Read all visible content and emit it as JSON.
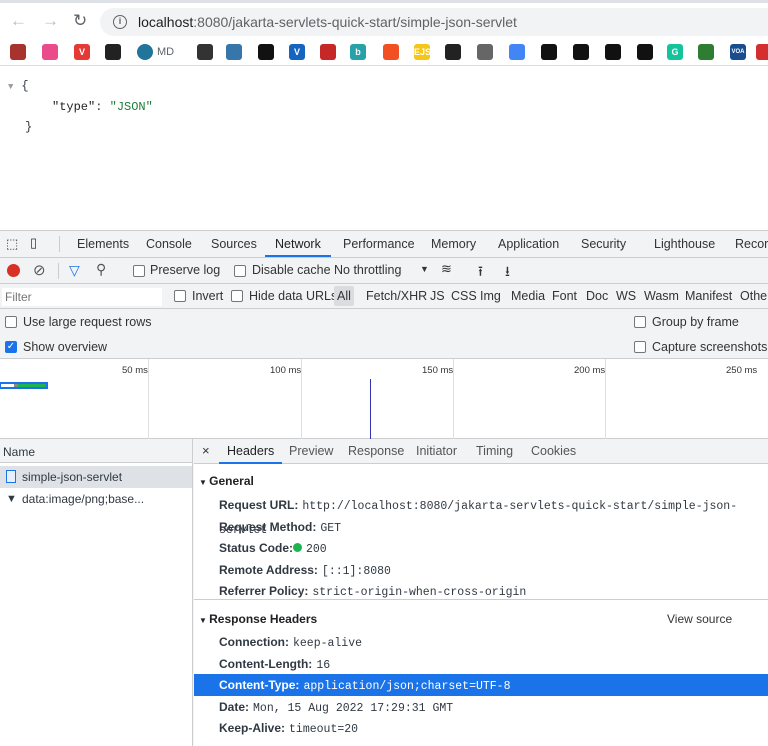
{
  "browser": {
    "url_host": "localhost",
    "url_rest": ":8080/jakarta-servlets-quick-start/simple-json-servlet",
    "bookmarks": [
      {
        "icon": "bars-icon",
        "color": "#a8322d",
        "label": ""
      },
      {
        "icon": "dribbble-icon",
        "color": "#ea4c89",
        "label": ""
      },
      {
        "icon": "vivaldi-icon",
        "color": "#e53935",
        "label": "V"
      },
      {
        "icon": "archive-icon",
        "color": "#222",
        "label": ""
      },
      {
        "icon": "wordpress-icon",
        "color": "#21759b",
        "label": "MD"
      },
      {
        "icon": "tomcat-icon",
        "color": "#333",
        "label": ""
      },
      {
        "icon": "python-icon",
        "color": "#3776ab",
        "label": ""
      },
      {
        "icon": "github-icon",
        "color": "#111",
        "label": ""
      },
      {
        "icon": "vuetify-icon",
        "color": "#1565c0",
        "label": "V"
      },
      {
        "icon": "red-circle-icon",
        "color": "#c62828",
        "label": ""
      },
      {
        "icon": "bing-icon",
        "color": "#27a2a8",
        "label": "b"
      },
      {
        "icon": "microsoft-icon",
        "color": "#f25022",
        "label": ""
      },
      {
        "icon": "ejs-icon",
        "color": "#f5c518",
        "label": "EJS"
      },
      {
        "icon": "archive-icon",
        "color": "#222",
        "label": ""
      },
      {
        "icon": "globe-icon",
        "color": "#666",
        "label": ""
      },
      {
        "icon": "google-docs-icon",
        "color": "#4285f4",
        "label": ""
      },
      {
        "icon": "github-icon",
        "color": "#111",
        "label": ""
      },
      {
        "icon": "github-icon",
        "color": "#111",
        "label": ""
      },
      {
        "icon": "github-icon",
        "color": "#111",
        "label": ""
      },
      {
        "icon": "github-icon",
        "color": "#111",
        "label": ""
      },
      {
        "icon": "grammarly-icon",
        "color": "#15c39a",
        "label": "G"
      },
      {
        "icon": "spring-icon",
        "color": "#2e7d32",
        "label": ""
      },
      {
        "icon": "voa-icon",
        "color": "#1a4d8f",
        "label": "VOA"
      },
      {
        "icon": "red-icon",
        "color": "#d32f2f",
        "label": ""
      }
    ]
  },
  "page": {
    "open": "{",
    "key": "\"type\"",
    "colon": ": ",
    "value": "\"JSON\"",
    "close": "}"
  },
  "devtools": {
    "tabs": [
      "Elements",
      "Console",
      "Sources",
      "Network",
      "Performance",
      "Memory",
      "Application",
      "Security",
      "Lighthouse",
      "Recorder"
    ],
    "active_tab": "Network",
    "toolbar": {
      "preserve_log": "Preserve log",
      "disable_cache": "Disable cache",
      "throttling": "No throttling"
    },
    "filter": {
      "placeholder": "Filter",
      "invert": "Invert",
      "hide_data_urls": "Hide data URLs",
      "types": [
        "All",
        "Fetch/XHR",
        "JS",
        "CSS",
        "Img",
        "Media",
        "Font",
        "Doc",
        "WS",
        "Wasm",
        "Manifest",
        "Other"
      ]
    },
    "options": {
      "large_rows": "Use large request rows",
      "show_overview": "Show overview",
      "group_by_frame": "Group by frame",
      "capture_screenshots": "Capture screenshots"
    },
    "overview_ticks": [
      "50 ms",
      "100 ms",
      "150 ms",
      "200 ms",
      "250 ms"
    ],
    "requests": {
      "header": "Name",
      "items": [
        "simple-json-servlet",
        "data:image/png;base..."
      ]
    },
    "detail_tabs": [
      "Headers",
      "Preview",
      "Response",
      "Initiator",
      "Timing",
      "Cookies"
    ],
    "general": {
      "title": "General",
      "rows": [
        {
          "k": "Request URL:",
          "v": "http://localhost:8080/jakarta-servlets-quick-start/simple-json-servlet"
        },
        {
          "k": "Request Method:",
          "v": "GET"
        },
        {
          "k": "Status Code:",
          "v": "200"
        },
        {
          "k": "Remote Address:",
          "v": "[::1]:8080"
        },
        {
          "k": "Referrer Policy:",
          "v": "strict-origin-when-cross-origin"
        }
      ]
    },
    "response_headers": {
      "title": "Response Headers",
      "view_source": "View source",
      "rows": [
        {
          "k": "Connection:",
          "v": "keep-alive"
        },
        {
          "k": "Content-Length:",
          "v": "16"
        },
        {
          "k": "Content-Type:",
          "v": "application/json;charset=UTF-8"
        },
        {
          "k": "Date:",
          "v": "Mon, 15 Aug 2022 17:29:31 GMT"
        },
        {
          "k": "Keep-Alive:",
          "v": "timeout=20"
        }
      ]
    },
    "status_color": "#1db34f",
    "accent": "#1a73e8"
  }
}
